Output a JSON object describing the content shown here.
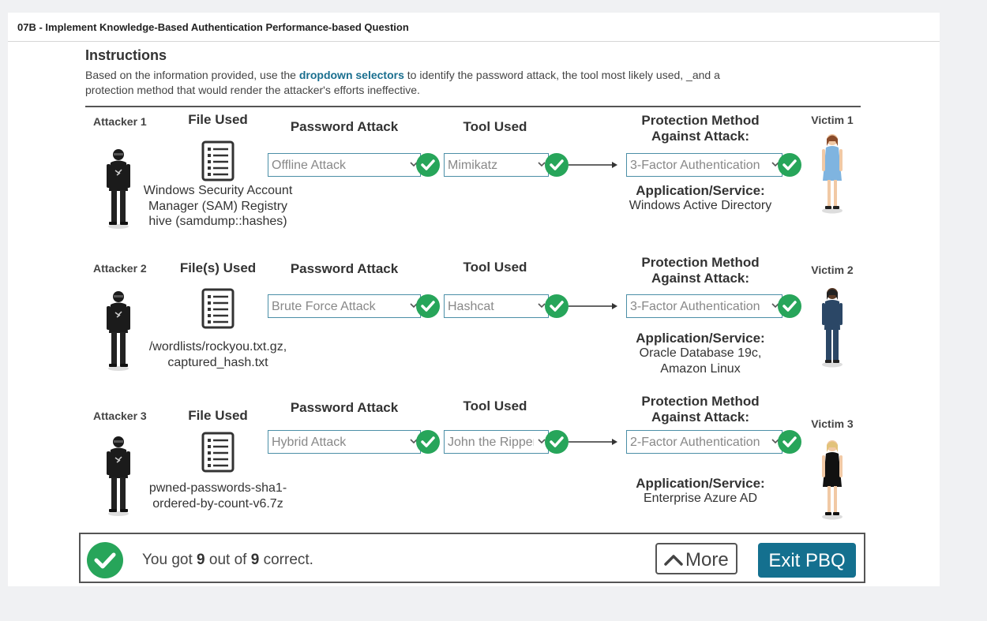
{
  "title": "07B - Implement Knowledge-Based Authentication Performance-based Question",
  "instructions": {
    "heading": "Instructions",
    "text_before": "Based on the information provided, use the ",
    "highlight": "dropdown selectors",
    "text_after": " to identify the password attack, the tool most likely used, _and a protection method that would render the attacker's efforts ineffective."
  },
  "rows": [
    {
      "attacker": "Attacker 1",
      "file_header": "File Used",
      "file_text": "Windows Security Account Manager (SAM) Registry hive (samdump::hashes)",
      "password_attack_header": "Password Attack",
      "password_attack": "Offline Attack",
      "tool_header": "Tool Used",
      "tool": "Mimikatz",
      "protection_header": "Protection Method Against Attack:",
      "protection": "3-Factor Authentication",
      "app_header": "Application/Service:",
      "app_text": "Windows Active Directory",
      "victim": "Victim 1"
    },
    {
      "attacker": "Attacker 2",
      "file_header": "File(s) Used",
      "file_text": "/wordlists/rockyou.txt.gz, captured_hash.txt",
      "password_attack_header": "Password Attack",
      "password_attack": "Brute Force Attack",
      "tool_header": "Tool Used",
      "tool": "Hashcat",
      "protection_header": "Protection Method Against Attack:",
      "protection": "3-Factor Authentication",
      "app_header": "Application/Service:",
      "app_text": "Oracle Database 19c, Amazon Linux",
      "victim": "Victim 2"
    },
    {
      "attacker": "Attacker 3",
      "file_header": "File Used",
      "file_text": "pwned-passwords-sha1-ordered-by-count-v6.7z",
      "password_attack_header": "Password Attack",
      "password_attack": "Hybrid Attack",
      "tool_header": "Tool Used",
      "tool": "John the Ripper",
      "protection_header": "Protection Method Against Attack:",
      "protection": "2-Factor Authentication",
      "app_header": "Application/Service:",
      "app_text": "Enterprise Azure AD",
      "victim": "Victim 3"
    }
  ],
  "footer": {
    "score_prefix": "You got ",
    "score_correct": "9",
    "score_mid": " out of ",
    "score_total": "9",
    "score_suffix": " correct.",
    "more_label": "More",
    "exit_label": "Exit PBQ"
  },
  "colors": {
    "accent": "#14708f",
    "check": "#27a55a",
    "select_border": "#4c8fa7"
  },
  "icons": [
    "checkmark-icon",
    "chevron-down-icon",
    "chevron-up-icon",
    "document-list-icon",
    "arrow-right-icon"
  ]
}
